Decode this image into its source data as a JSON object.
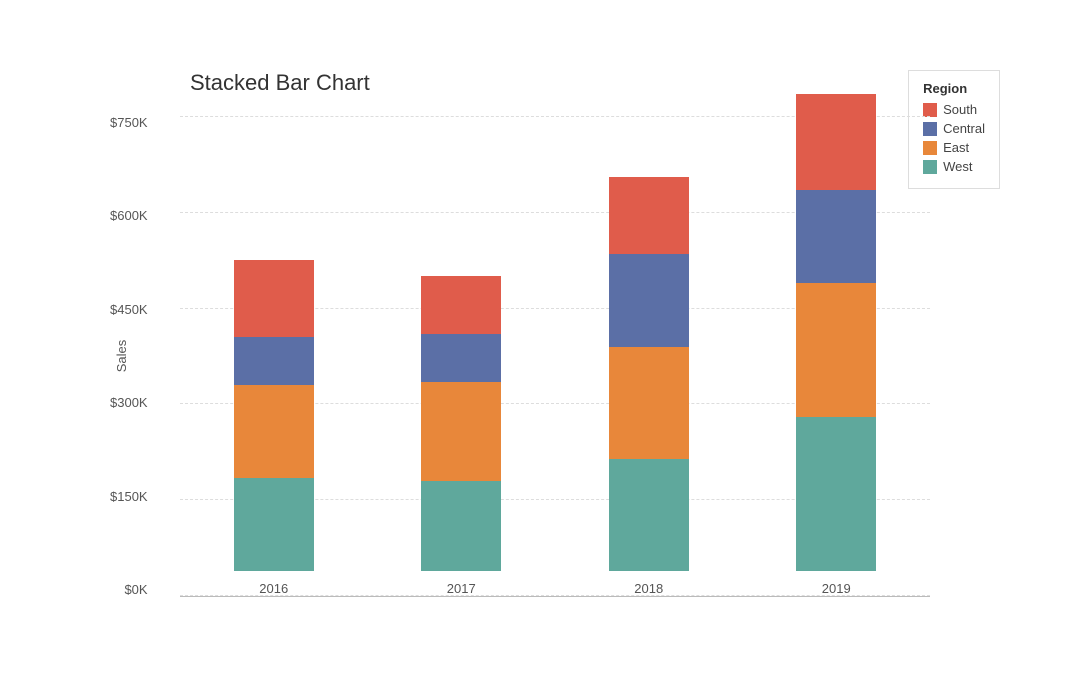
{
  "title": "Stacked Bar Chart",
  "yAxisTitle": "Sales",
  "colors": {
    "south": "#e05c4b",
    "central": "#5b6fa6",
    "east": "#e8873a",
    "west": "#5fa89c"
  },
  "yAxisLabels": [
    "$750K",
    "$600K",
    "$450K",
    "$300K",
    "$150K",
    "$0K"
  ],
  "legend": {
    "title": "Region",
    "items": [
      {
        "label": "South",
        "color": "#e05c4b"
      },
      {
        "label": "Central",
        "color": "#5b6fa6"
      },
      {
        "label": "East",
        "color": "#e8873a"
      },
      {
        "label": "West",
        "color": "#5fa89c"
      }
    ]
  },
  "bars": [
    {
      "year": "2016",
      "west": 145,
      "east": 145,
      "central": 75,
      "south": 120
    },
    {
      "year": "2017",
      "west": 140,
      "east": 155,
      "central": 75,
      "south": 90
    },
    {
      "year": "2018",
      "west": 175,
      "east": 175,
      "central": 145,
      "south": 120
    },
    {
      "year": "2019",
      "west": 240,
      "east": 210,
      "central": 145,
      "south": 150
    }
  ],
  "maxValue": 750
}
